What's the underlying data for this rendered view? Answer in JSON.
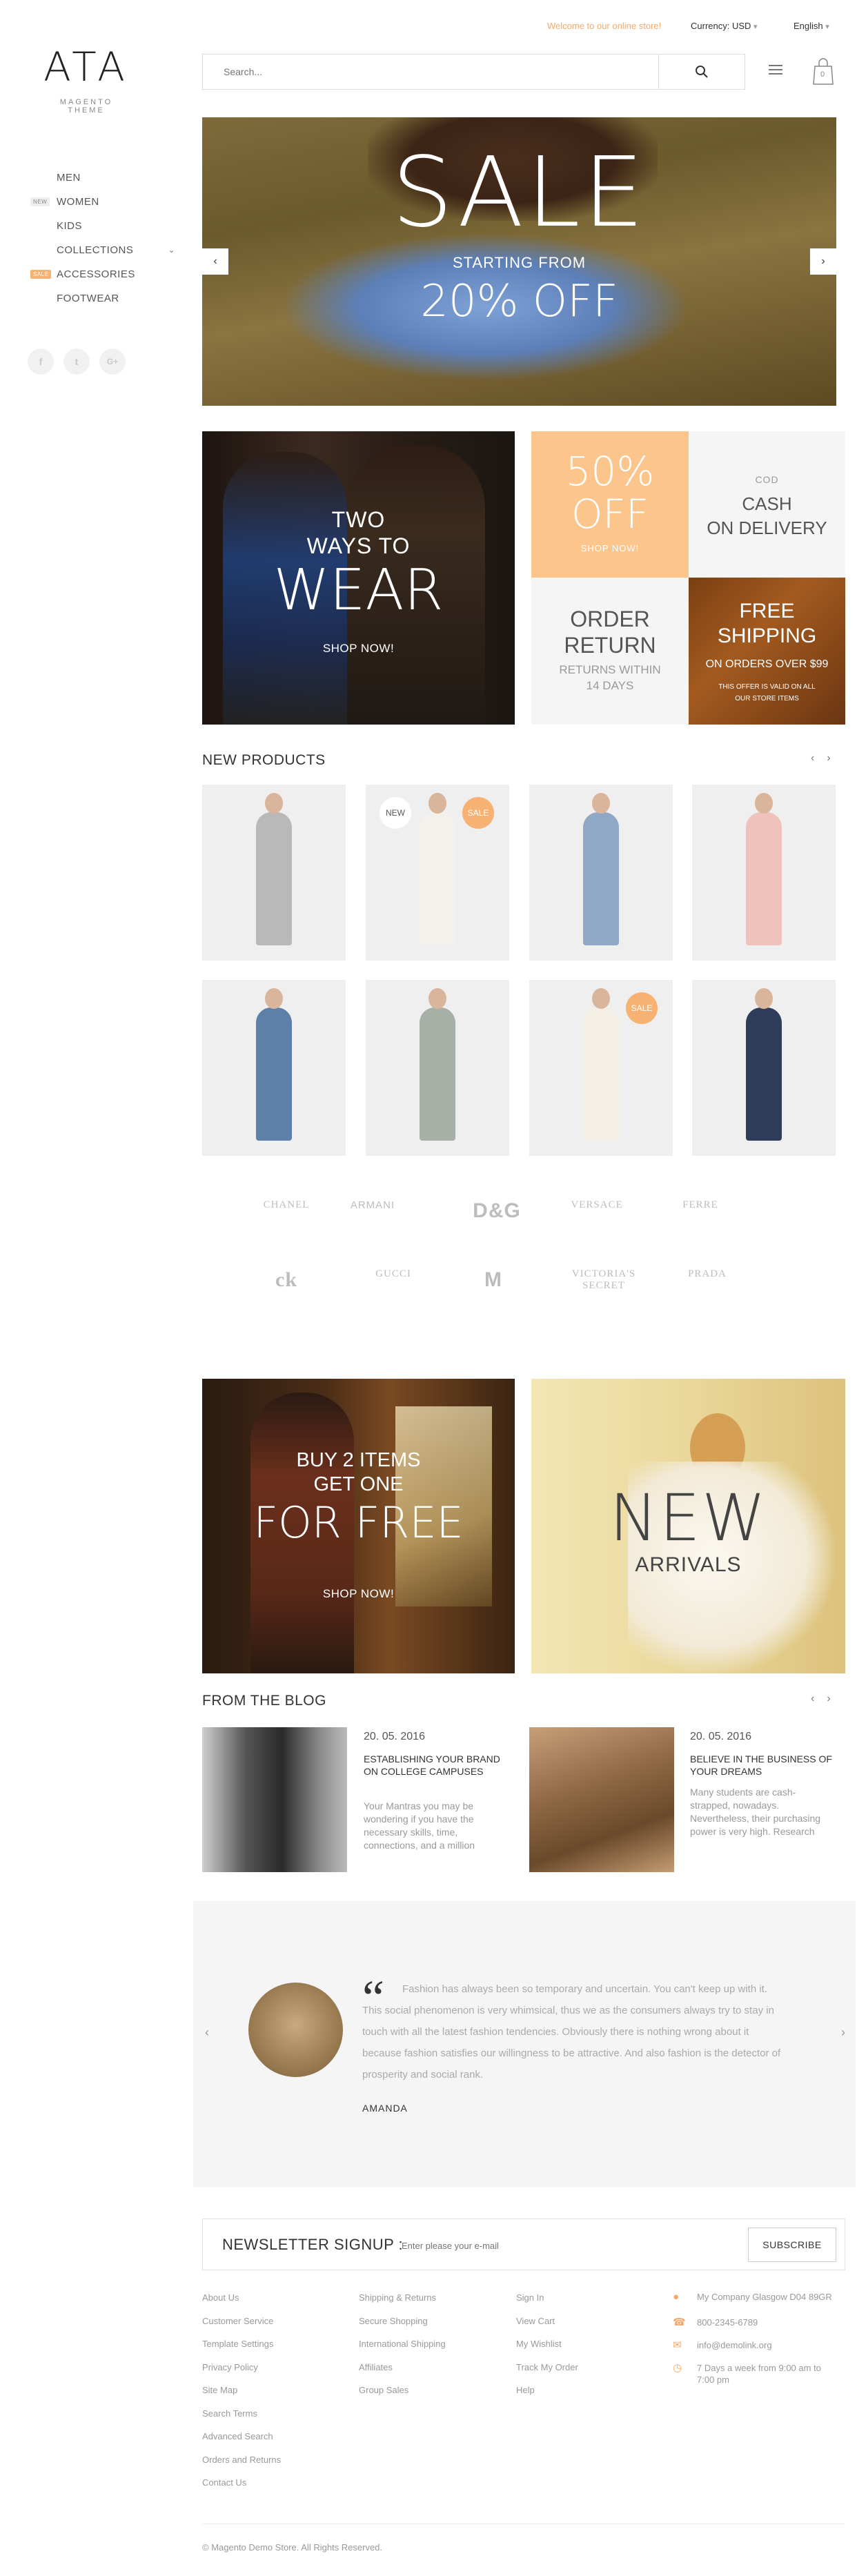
{
  "logo": {
    "mark": "ATA",
    "subtitle": "MAGENTO THEME"
  },
  "sidebar": {
    "items": [
      {
        "label": "MEN",
        "badge": ""
      },
      {
        "label": "WOMEN",
        "badge": "NEW"
      },
      {
        "label": "KIDS",
        "badge": ""
      },
      {
        "label": "COLLECTIONS",
        "badge": ""
      },
      {
        "label": "ACCESSORIES",
        "badge": "SALE"
      },
      {
        "label": "FOOTWEAR",
        "badge": ""
      }
    ],
    "socials": [
      "f",
      "t",
      "G+"
    ]
  },
  "topbar": {
    "welcome": "Welcome to our online store!",
    "currency": "Currency: USD",
    "language": "English"
  },
  "search": {
    "placeholder": "Search..."
  },
  "cart": {
    "count": "0"
  },
  "hero": {
    "title": "SALE",
    "subtitle": "STARTING FROM",
    "discount": "20% OFF"
  },
  "promo_wear": {
    "line1": "TWO",
    "line2": "WAYS TO",
    "line3": "WEAR",
    "cta": "SHOP NOW!"
  },
  "tile_50": {
    "line1": "50%",
    "line2": "OFF",
    "cta": "SHOP NOW!"
  },
  "tile_cod": {
    "line1": "COD",
    "line2": "CASH",
    "line3": "ON DELIVERY"
  },
  "tile_return": {
    "line1": "ORDER",
    "line2": "RETURN",
    "line3": "RETURNS WITHIN",
    "line4": "14 DAYS"
  },
  "tile_shipping": {
    "line1": "FREE",
    "line2": "SHIPPING",
    "line3": "ON ORDERS OVER $99",
    "line4": "THIS OFFER IS VALID ON ALL",
    "line5": "OUR STORE ITEMS"
  },
  "new_products": {
    "title": "NEW PRODUCTS",
    "products": [
      {
        "badges": [],
        "color": "#b9b9b9"
      },
      {
        "badges": [
          "NEW",
          "SALE"
        ],
        "color": "#f4f1ec"
      },
      {
        "badges": [],
        "color": "#8fa8c6"
      },
      {
        "badges": [],
        "color": "#efc3bc"
      },
      {
        "badges": [],
        "color": "#5e7fa8"
      },
      {
        "badges": [],
        "color": "#a7b0a6"
      },
      {
        "badges": [
          "SALE"
        ],
        "color": "#f4efe4"
      },
      {
        "badges": [],
        "color": "#2f3d5a"
      }
    ]
  },
  "brands": [
    "CHANEL",
    "ARMANI",
    "D&G",
    "VERSACE",
    "FERRE",
    "ck",
    "GUCCI",
    "M",
    "VICTORIA'S SECRET",
    "PRADA"
  ],
  "promo_free": {
    "line1": "BUY 2 ITEMS",
    "line2": "GET ONE",
    "line3": "FOR FREE",
    "cta": "SHOP NOW!"
  },
  "promo_new": {
    "line1": "NEW",
    "line2": "ARRIVALS"
  },
  "blog": {
    "title": "FROM THE BLOG",
    "posts": [
      {
        "date": "20. 05. 2016",
        "title": "ESTABLISHING YOUR BRAND ON COLLEGE CAMPUSES",
        "excerpt": "Your Mantras you may be wondering if you have the necessary skills, time, connections, and a million"
      },
      {
        "date": "20. 05. 2016",
        "title": "BELIEVE IN THE BUSINESS OF YOUR DREAMS",
        "excerpt": "Many students are cash-strapped, nowadays. Nevertheless, their purchasing power is very high. Research"
      }
    ]
  },
  "testimonial": {
    "quote": "Fashion has always been so temporary and uncertain. You can't keep up with it. This social phenomenon is very whimsical, thus we as the consumers always try to stay in touch with all the latest fashion tendencies. Obviously there is nothing wrong about it because fashion satisfies our willingness to be attractive. And also fashion is the detector of prosperity and social rank.",
    "author": "AMANDA"
  },
  "newsletter": {
    "title": "NEWSLETTER SIGNUP :",
    "placeholder": "Enter please your e-mail",
    "button": "SUBSCRIBE"
  },
  "footer": {
    "col1": [
      "About Us",
      "Customer Service",
      "Template Settings",
      "Privacy Policy",
      "Site Map",
      "Search Terms",
      "Advanced Search",
      "Orders and Returns",
      "Contact Us"
    ],
    "col2": [
      "Shipping & Returns",
      "Secure Shopping",
      "International Shipping",
      "Affiliates",
      "Group Sales"
    ],
    "col3": [
      "Sign In",
      "View Cart",
      "My Wishlist",
      "Track My Order",
      "Help"
    ],
    "contact": {
      "address": "My Company Glasgow D04 89GR",
      "phone": "800-2345-6789",
      "email": "info@demolink.org",
      "hours": "7 Days a week from 9:00 am to 7:00 pm"
    },
    "copyright": "© Magento Demo Store. All Rights Reserved."
  }
}
